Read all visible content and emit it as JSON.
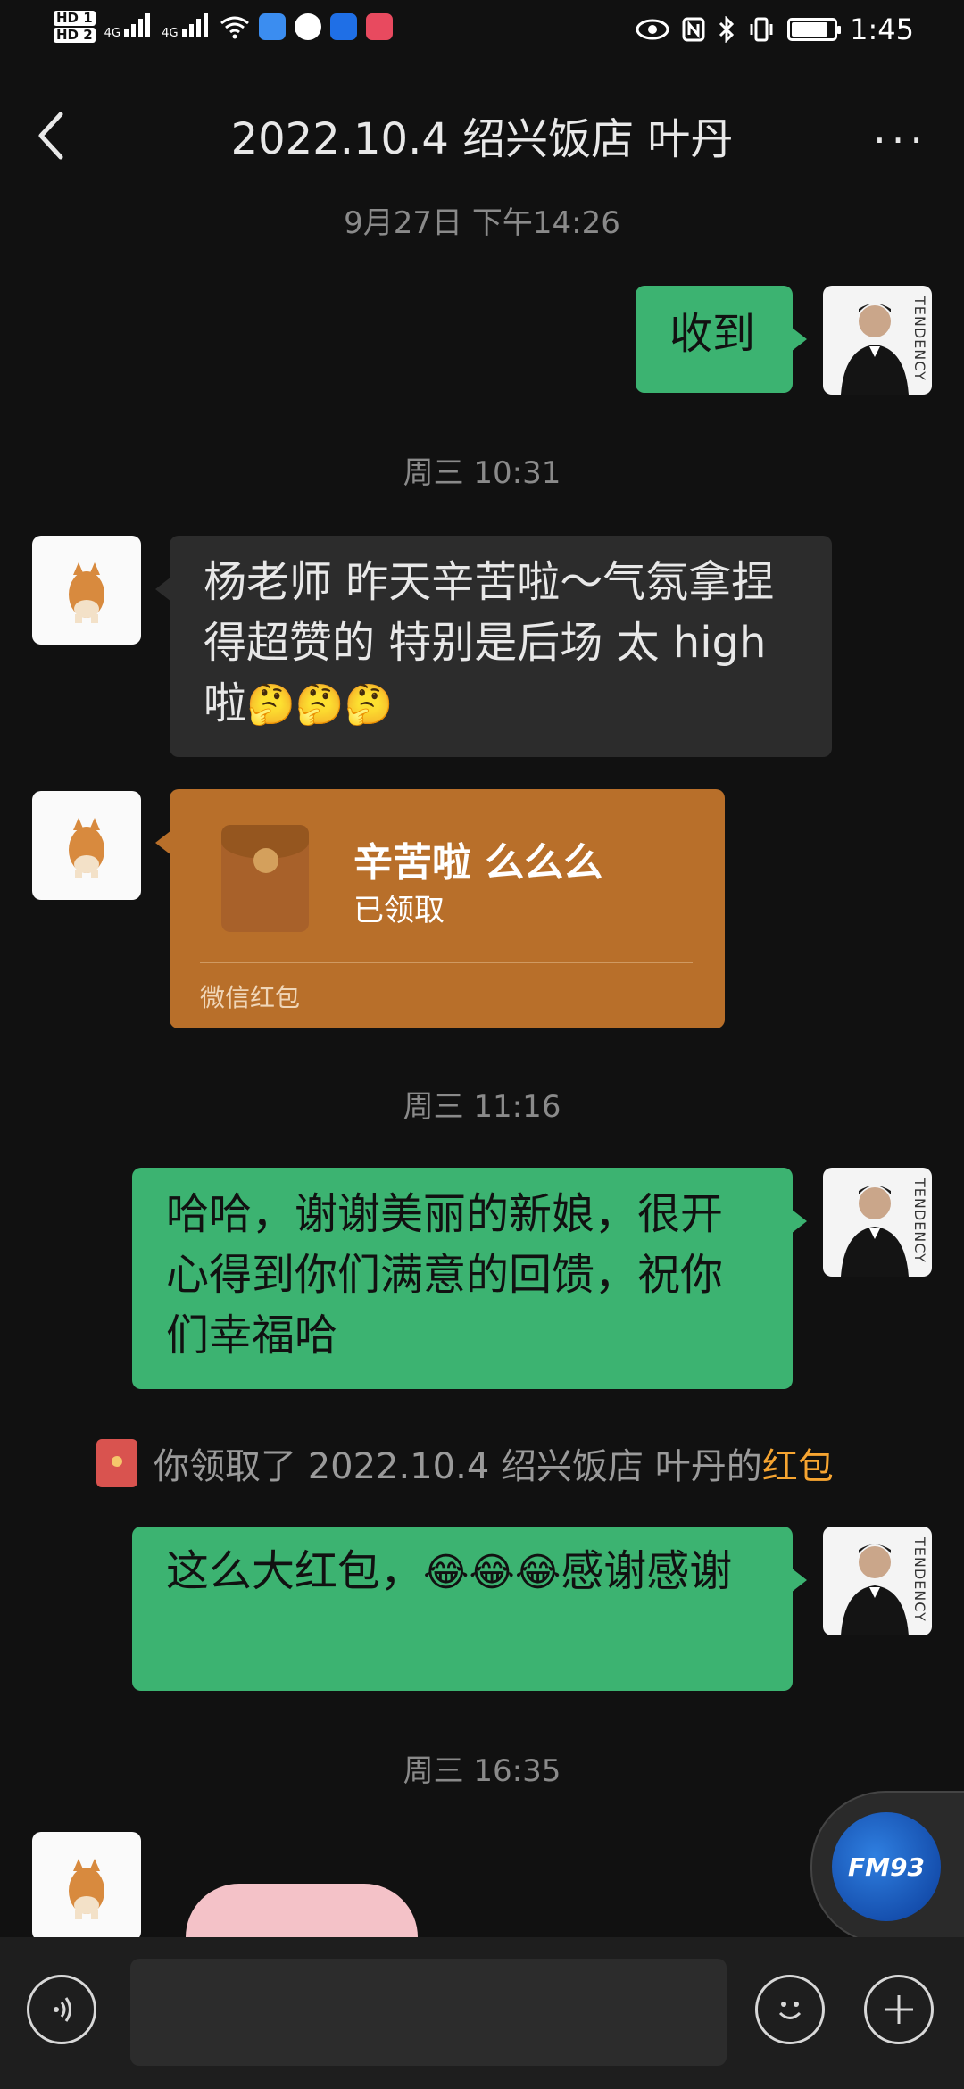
{
  "status_bar": {
    "hd1": "HD 1",
    "hd2": "HD 2",
    "net1": "4G",
    "net2": "4G",
    "time": "1:45"
  },
  "header": {
    "title": "2022.10.4  绍兴饭店 叶丹",
    "more": "···"
  },
  "messages": {
    "ts1": "9月27日 下午14:26",
    "m1": "收到",
    "ts2": "周三 10:31",
    "m2_text": "杨老师 昨天辛苦啦～气氛拿捏得超赞的 特别是后场 太 high 啦",
    "m2_emoji": "🤔🤔🤔",
    "red_packet": {
      "title": "辛苦啦 么么么",
      "status": "已领取",
      "footer": "微信红包"
    },
    "ts3": "周三 11:16",
    "m3": "哈哈，谢谢美丽的新娘，很开心得到你们满意的回馈，祝你们幸福哈",
    "system_text": "你领取了 2022.10.4  绍兴饭店 叶丹的",
    "system_link": "红包",
    "m4_a": "这么大红包，",
    "m4_emoji": "😂😂😂",
    "m4_b": "感谢感谢",
    "ts4": "周三 16:35"
  },
  "avatar_brand": "TENDENCY",
  "float_widget": "FM93",
  "colors": {
    "bubble_green": "#3cb371",
    "red_packet": "#b86f2a",
    "link_orange": "#f7a531"
  }
}
